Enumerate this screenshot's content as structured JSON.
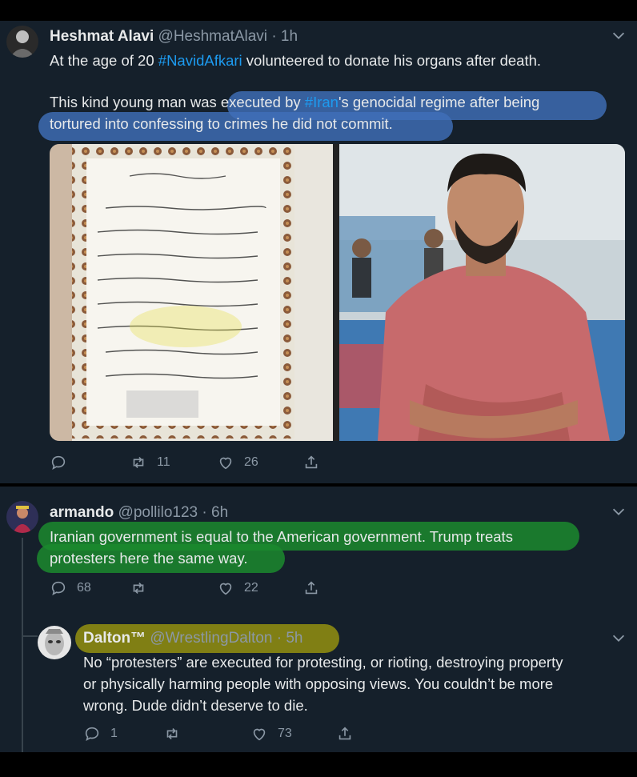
{
  "tweet1": {
    "name": "Heshmat Alavi",
    "handle": "@HeshmatAlavi",
    "time": "· 1h",
    "line1_pre": "At the age of 20 ",
    "line1_tag": "#NavidAfkari",
    "line1_post": " volunteered to donate his organs after death.",
    "line2_pre": "This kind young man was executed by ",
    "line2_tag": "#Iran",
    "line2_post": "'s genocidal regime after being",
    "line3": "tortured into confessing to crimes he did not commit.",
    "replies": "",
    "retweets": "11",
    "likes": "26",
    "highlight_color": "#3f6fb8"
  },
  "tweet2": {
    "name": "armando",
    "handle": "@pollilo123",
    "time": "· 6h",
    "line1": "Iranian government is equal to the American government. Trump treats",
    "line2": "protesters here the same way.",
    "replies": "68",
    "retweets": "",
    "likes": "22",
    "highlight_color": "#1b8a2e"
  },
  "tweet3": {
    "name": "Dalton™",
    "handle": "@WrestlingDalton",
    "time": "· 5h",
    "line1": "No “protesters” are executed for protesting, or rioting, destroying property",
    "line2": "or physically harming people with opposing views. You couldn’t be more",
    "line3": "wrong. Dude didn’t deserve to die.",
    "replies": "1",
    "retweets": "",
    "likes": "73",
    "highlight_color": "#8c8a12"
  },
  "colors": {
    "bg": "#15202b",
    "link": "#1d9bf0",
    "muted": "#8b98a5"
  }
}
